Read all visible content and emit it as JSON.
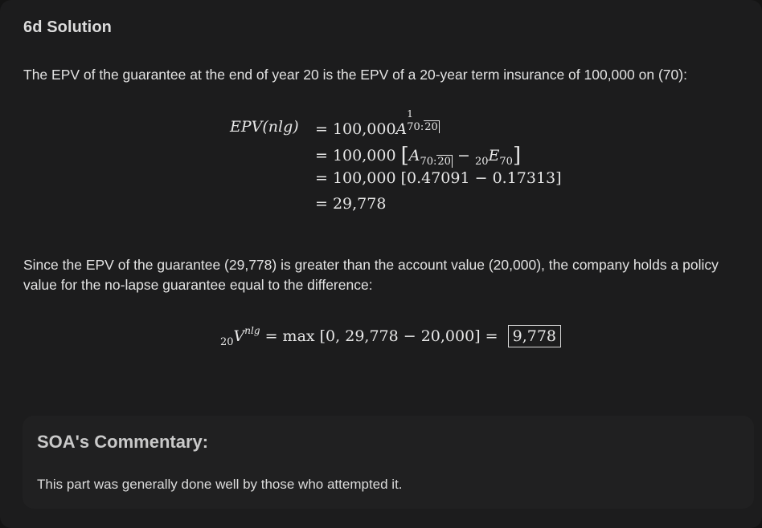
{
  "section": {
    "heading": "6d Solution"
  },
  "paragraphs": {
    "intro": "The EPV of the guarantee at the end of year 20 is the EPV of a 20-year term insurance of 100,000 on (70):",
    "conclusion": "Since the EPV of the guarantee (29,778) is greater than the account value (20,000), the company holds a policy value for the no-lapse guarantee equal to the difference:"
  },
  "equation1": {
    "lhs": "EPV(nlg)",
    "row1": {
      "eq": "=",
      "coef": "100,000",
      "sym": "A",
      "sup": "1",
      "sub_left": "70:",
      "sub_angle": "20"
    },
    "row2": {
      "eq": "=",
      "coef": "100,000",
      "sym_a": "A",
      "sub_left": "70:",
      "sub_angle": "20",
      "minus": "−",
      "pre_sub": "20",
      "sym_e": "E",
      "sub_e": "70"
    },
    "row3": {
      "eq": "=",
      "text": "100,000",
      "bracket": "[0.47091 − 0.17313]"
    },
    "row4": {
      "eq": "=",
      "text": "29,778"
    }
  },
  "equation2": {
    "pre_sub": "20",
    "sym": "V",
    "sup": "nlg",
    "eq": "=",
    "expr": "max [0, 29,778 − 20,000]",
    "eq2": "=",
    "result": "9,778"
  },
  "commentary": {
    "title": "SOA's Commentary:",
    "text": "This part was generally done well by those who attempted it."
  }
}
